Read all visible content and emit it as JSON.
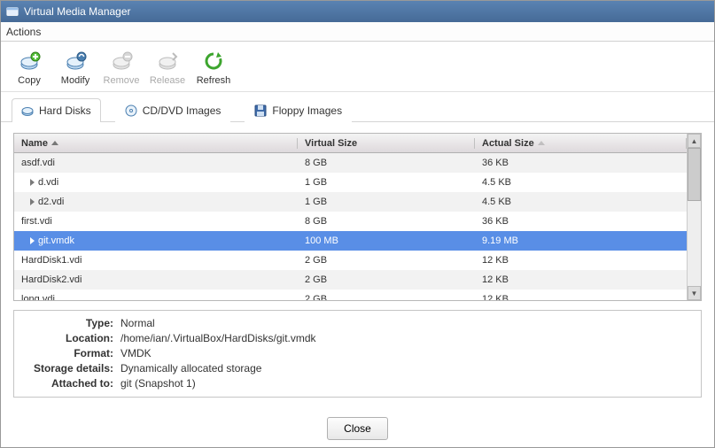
{
  "window": {
    "title": "Virtual Media Manager"
  },
  "menubar": {
    "actions": "Actions"
  },
  "toolbar": {
    "copy": "Copy",
    "modify": "Modify",
    "remove": "Remove",
    "release": "Release",
    "refresh": "Refresh"
  },
  "tabs": {
    "hard_disks": "Hard Disks",
    "cd_dvd": "CD/DVD Images",
    "floppy": "Floppy Images"
  },
  "table": {
    "headers": {
      "name": "Name",
      "virtual_size": "Virtual Size",
      "actual_size": "Actual Size"
    },
    "rows": [
      {
        "name": "asdf.vdi",
        "virtual_size": "8 GB",
        "actual_size": "36 KB",
        "child": false,
        "selected": false
      },
      {
        "name": "d.vdi",
        "virtual_size": "1 GB",
        "actual_size": "4.5 KB",
        "child": true,
        "selected": false
      },
      {
        "name": "d2.vdi",
        "virtual_size": "1 GB",
        "actual_size": "4.5 KB",
        "child": true,
        "selected": false
      },
      {
        "name": "first.vdi",
        "virtual_size": "8 GB",
        "actual_size": "36 KB",
        "child": false,
        "selected": false
      },
      {
        "name": "git.vmdk",
        "virtual_size": "100 MB",
        "actual_size": "9.19 MB",
        "child": true,
        "selected": true
      },
      {
        "name": "HardDisk1.vdi",
        "virtual_size": "2 GB",
        "actual_size": "12 KB",
        "child": false,
        "selected": false
      },
      {
        "name": "HardDisk2.vdi",
        "virtual_size": "2 GB",
        "actual_size": "12 KB",
        "child": false,
        "selected": false
      },
      {
        "name": "long.vdi",
        "virtual_size": "2 GB",
        "actual_size": "12 KB",
        "child": false,
        "selected": false
      }
    ]
  },
  "details": {
    "labels": {
      "type": "Type:",
      "location": "Location:",
      "format": "Format:",
      "storage": "Storage details:",
      "attached": "Attached to:"
    },
    "values": {
      "type": "Normal",
      "location": "/home/ian/.VirtualBox/HardDisks/git.vmdk",
      "format": "VMDK",
      "storage": "Dynamically allocated storage",
      "attached": "git (Snapshot 1)"
    }
  },
  "footer": {
    "close": "Close"
  },
  "colors": {
    "titlebar": "#466b97",
    "selection": "#598ee6"
  }
}
